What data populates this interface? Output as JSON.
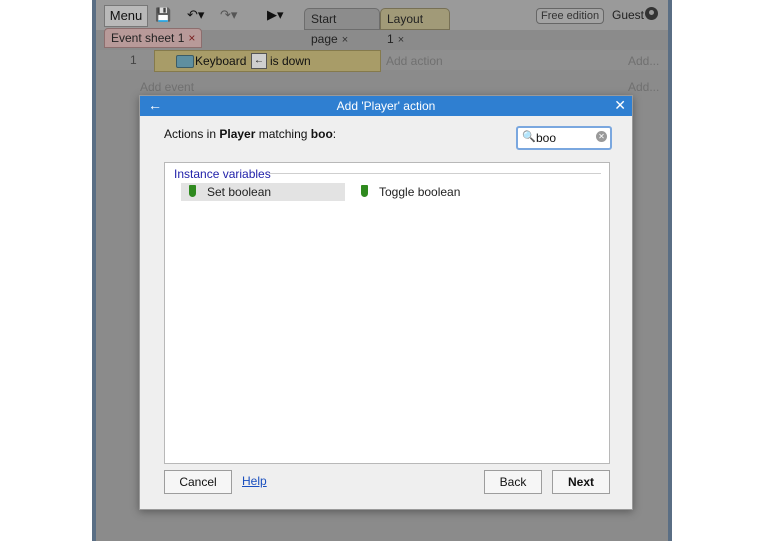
{
  "toolbar": {
    "menu_label": "Menu",
    "tabs": [
      {
        "label": "Start page",
        "close": "×"
      },
      {
        "label": "Layout 1",
        "close": "×"
      }
    ],
    "edition_badge": "Free edition",
    "user_label": "Guest"
  },
  "event_sheet": {
    "tab_label": "Event sheet 1",
    "tab_close": "×",
    "rows": [
      {
        "number": "1",
        "object": "Keyboard",
        "key_glyph": "←",
        "condition": "is down",
        "add_action": "Add action",
        "more": "Add..."
      }
    ],
    "add_event": "Add event",
    "add_event_more": "Add..."
  },
  "dialog": {
    "title": "Add 'Player' action",
    "prompt_prefix": "Actions in",
    "object_name": "Player",
    "prompt_middle": "matching",
    "query": "boo",
    "prompt_suffix": ":",
    "search_value": "boo",
    "group_label": "Instance variables",
    "items": [
      {
        "label": "Set boolean",
        "selected": true
      },
      {
        "label": "Toggle boolean",
        "selected": false
      }
    ],
    "cancel_label": "Cancel",
    "help_label": "Help",
    "back_label": "Back",
    "next_label": "Next"
  },
  "colors": {
    "title_bar": "#2f7fd1",
    "group_header": "#2222aa",
    "var_icon": "#2f8a1f"
  }
}
